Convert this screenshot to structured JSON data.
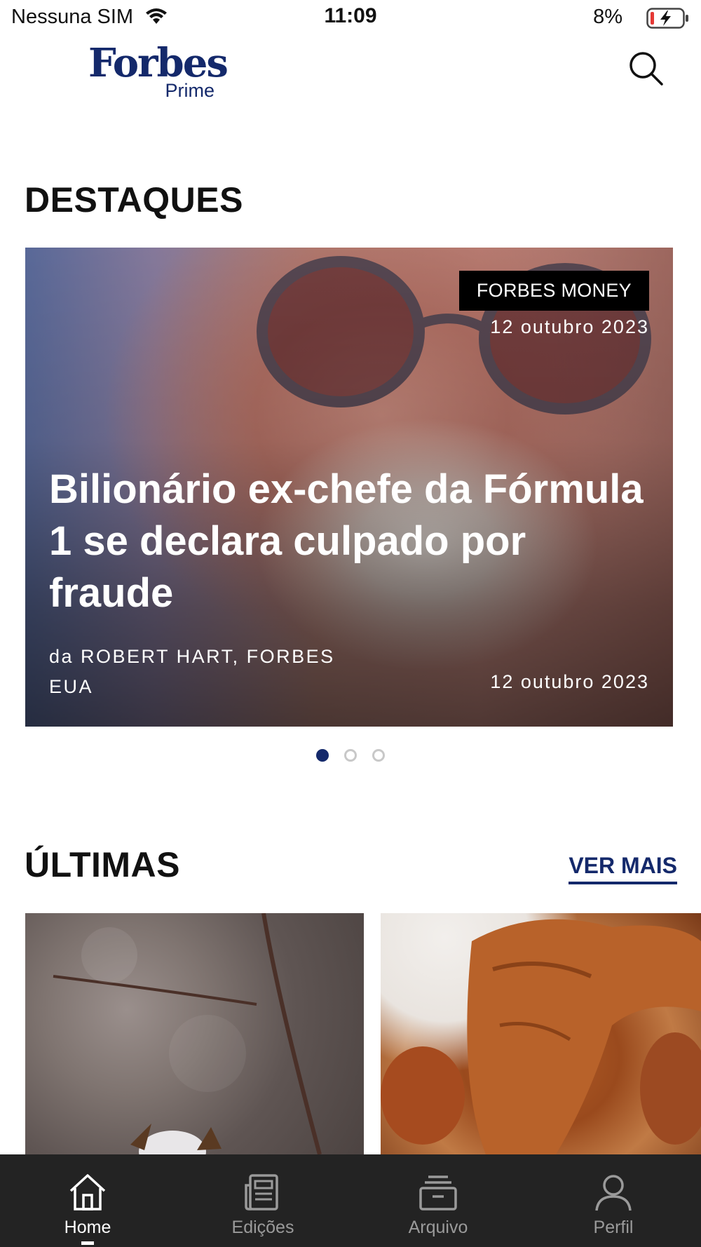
{
  "status_bar": {
    "carrier": "Nessuna SIM",
    "time": "11:09",
    "battery_pct": "8%",
    "battery_level": 0.08,
    "charging": true
  },
  "header": {
    "logo_main": "Forbes",
    "logo_sub": "Prime",
    "logo_color": "#14296b",
    "search_icon": "search-icon"
  },
  "sections": {
    "destaques_title": "DESTAQUES",
    "ultimas_title": "ÚLTIMAS",
    "ver_mais": "VER MAIS"
  },
  "featured": {
    "category": "FORBES MONEY",
    "date_top": "12 outubro 2023",
    "title": "Bilionário ex-chefe da Fórmula 1 se declara culpado por fraude",
    "byline": "da ROBERT HART, FORBES EUA",
    "date_bottom": "12 outubro 2023"
  },
  "carousel": {
    "total": 3,
    "active_index": 0,
    "active_color": "#14296b"
  },
  "latest_cards": [
    {
      "image": "cotton-plant-photo"
    },
    {
      "image": "fried-chicken-wings-photo"
    }
  ],
  "bottom_nav": {
    "items": [
      {
        "label": "Home",
        "icon": "home-icon",
        "active": true
      },
      {
        "label": "Edições",
        "icon": "newspaper-icon",
        "active": false
      },
      {
        "label": "Arquivo",
        "icon": "archive-icon",
        "active": false
      },
      {
        "label": "Perfil",
        "icon": "user-icon",
        "active": false
      }
    ]
  }
}
